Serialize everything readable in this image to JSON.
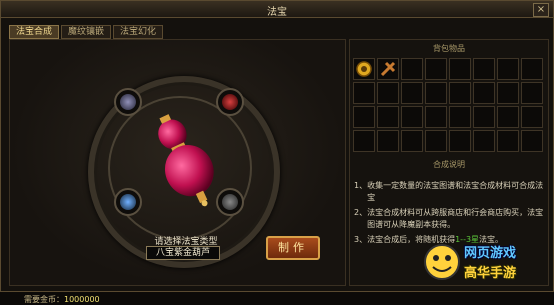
{
  "window": {
    "title": "法宝",
    "close_glyph": "×"
  },
  "tabs": [
    {
      "label": "法宝合成",
      "active": true
    },
    {
      "label": "魔纹镶嵌",
      "active": false
    },
    {
      "label": "法宝幻化",
      "active": false
    }
  ],
  "synthesis": {
    "select_label": "请选择法宝类型",
    "selected_type": "八宝紫金葫芦",
    "make_button": "制作",
    "gold_label": "需要金币：",
    "gold_value": "1000000"
  },
  "bag": {
    "title": "背包物品",
    "items": [
      {
        "slot": 0,
        "icon": "gold-ring-icon"
      },
      {
        "slot": 1,
        "icon": "bronze-cross-icon"
      }
    ]
  },
  "instructions": {
    "title": "合成说明",
    "items": [
      {
        "num": "1、",
        "text": "收集一定数量的法宝图谱和法宝合成材料可合成法宝"
      },
      {
        "num": "2、",
        "text": "法宝合成材料可从跨服商店和行会商店购买，法宝图谱可从降魔副本获得。"
      },
      {
        "num": "3、",
        "text_before": "法宝合成后，将随机获得",
        "highlight": "1--3星",
        "text_after": "法宝。"
      }
    ]
  },
  "watermark": {
    "line1": "网页游戏",
    "line2": "高华手游"
  },
  "colors": {
    "highlight_green": "#5cc63a",
    "button_orange": "#a84b1c",
    "gold": "#f0e070"
  }
}
